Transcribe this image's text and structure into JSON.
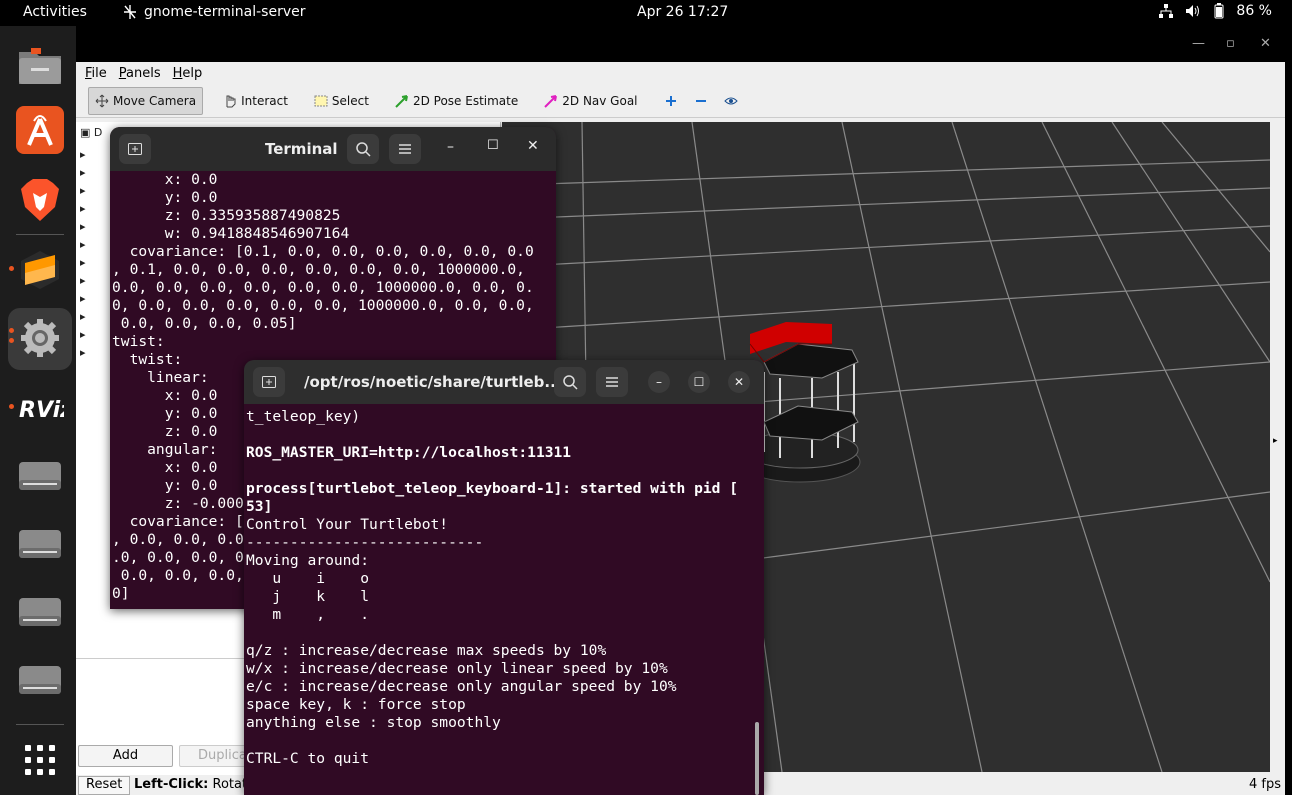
{
  "topbar": {
    "activities": "Activities",
    "app_name": "gnome-terminal-server",
    "clock": "Apr 26  17:27",
    "battery": "86 %"
  },
  "dock": {
    "items": [
      "files-icon",
      "app-center-icon",
      "brave-icon",
      "sublime-icon",
      "settings-icon",
      "rviz-icon",
      "drive-icon",
      "drive-icon",
      "drive-icon",
      "drive-icon",
      "app-grid-icon"
    ]
  },
  "rviz": {
    "menu": [
      "File",
      "Panels",
      "Help"
    ],
    "tools": {
      "move_camera": "Move Camera",
      "interact": "Interact",
      "select": "Select",
      "pose_estimate": "2D Pose Estimate",
      "nav_goal": "2D Nav Goal"
    },
    "displays_header": "D",
    "add_label": "Add",
    "duplicate_label": "Duplica",
    "reset_label": "Reset",
    "hint_bold": "Left-Click:",
    "hint_text": " Rotate",
    "fps": "4 fps",
    "colors": {
      "ground": "#2f2f2f",
      "grid": "#8a8a8a",
      "robot_red": "#d00000"
    }
  },
  "terminal1": {
    "title": "Terminal",
    "lines": [
      "      x: 0.0",
      "      y: 0.0",
      "      z: 0.335935887490825",
      "      w: 0.9418848546907164",
      "  covariance: [0.1, 0.0, 0.0, 0.0, 0.0, 0.0, 0.0",
      ", 0.1, 0.0, 0.0, 0.0, 0.0, 0.0, 0.0, 1000000.0,",
      "0.0, 0.0, 0.0, 0.0, 0.0, 0.0, 1000000.0, 0.0, 0.",
      "0, 0.0, 0.0, 0.0, 0.0, 0.0, 1000000.0, 0.0, 0.0,",
      " 0.0, 0.0, 0.0, 0.05]",
      "twist:",
      "  twist:",
      "    linear:",
      "      x: 0.0",
      "      y: 0.0",
      "      z: 0.0",
      "    angular:",
      "      x: 0.0",
      "      y: 0.0",
      "      z: -0.000",
      "  covariance: [",
      ", 0.0, 0.0, 0.0",
      ".0, 0.0, 0.0, 0",
      " 0.0, 0.0, 0.0,",
      "0]"
    ]
  },
  "terminal2": {
    "title": "/opt/ros/noetic/share/turtleb...",
    "lines": [
      {
        "t": "t_teleop_key)",
        "b": false
      },
      {
        "t": "",
        "b": false
      },
      {
        "t": "ROS_MASTER_URI=http://localhost:11311",
        "b": true
      },
      {
        "t": "",
        "b": false
      },
      {
        "t": "process[turtlebot_teleop_keyboard-1]: started with pid [",
        "b": true
      },
      {
        "t": "53]",
        "b": true
      },
      {
        "t": "Control Your Turtlebot!",
        "b": false
      },
      {
        "t": "---------------------------",
        "b": false
      },
      {
        "t": "Moving around:",
        "b": false
      },
      {
        "t": "   u    i    o",
        "b": false
      },
      {
        "t": "   j    k    l",
        "b": false
      },
      {
        "t": "   m    ,    .",
        "b": false
      },
      {
        "t": "",
        "b": false
      },
      {
        "t": "q/z : increase/decrease max speeds by 10%",
        "b": false
      },
      {
        "t": "w/x : increase/decrease only linear speed by 10%",
        "b": false
      },
      {
        "t": "e/c : increase/decrease only angular speed by 10%",
        "b": false
      },
      {
        "t": "space key, k : force stop",
        "b": false
      },
      {
        "t": "anything else : stop smoothly",
        "b": false
      },
      {
        "t": "",
        "b": false
      },
      {
        "t": "CTRL-C to quit",
        "b": false
      }
    ]
  }
}
